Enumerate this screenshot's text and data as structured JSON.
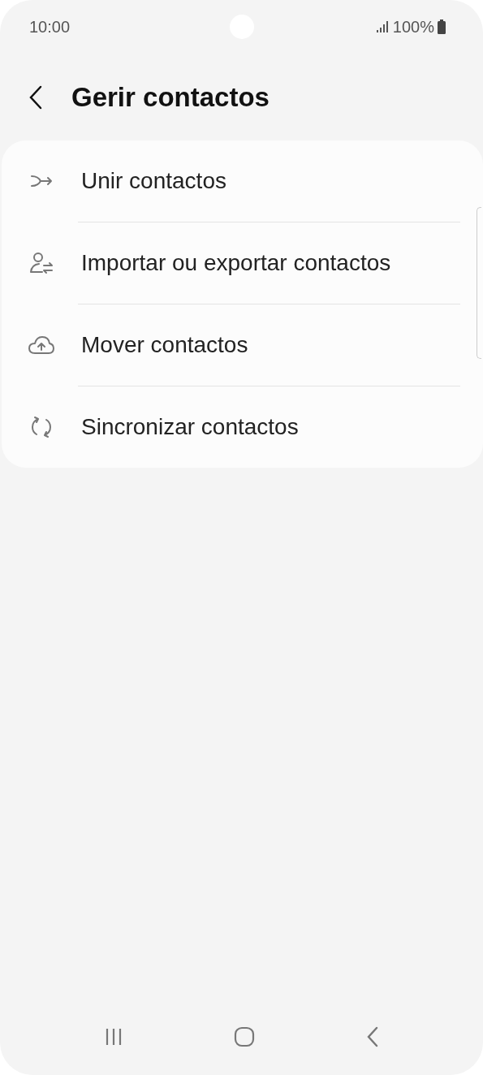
{
  "status_bar": {
    "time": "10:00",
    "battery": "100%"
  },
  "header": {
    "title": "Gerir contactos"
  },
  "items": [
    {
      "kind": "merge",
      "label": "Unir contactos"
    },
    {
      "kind": "import",
      "label": "Importar ou exportar contactos"
    },
    {
      "kind": "move",
      "label": "Mover contactos"
    },
    {
      "kind": "sync",
      "label": "Sincronizar contactos"
    }
  ]
}
